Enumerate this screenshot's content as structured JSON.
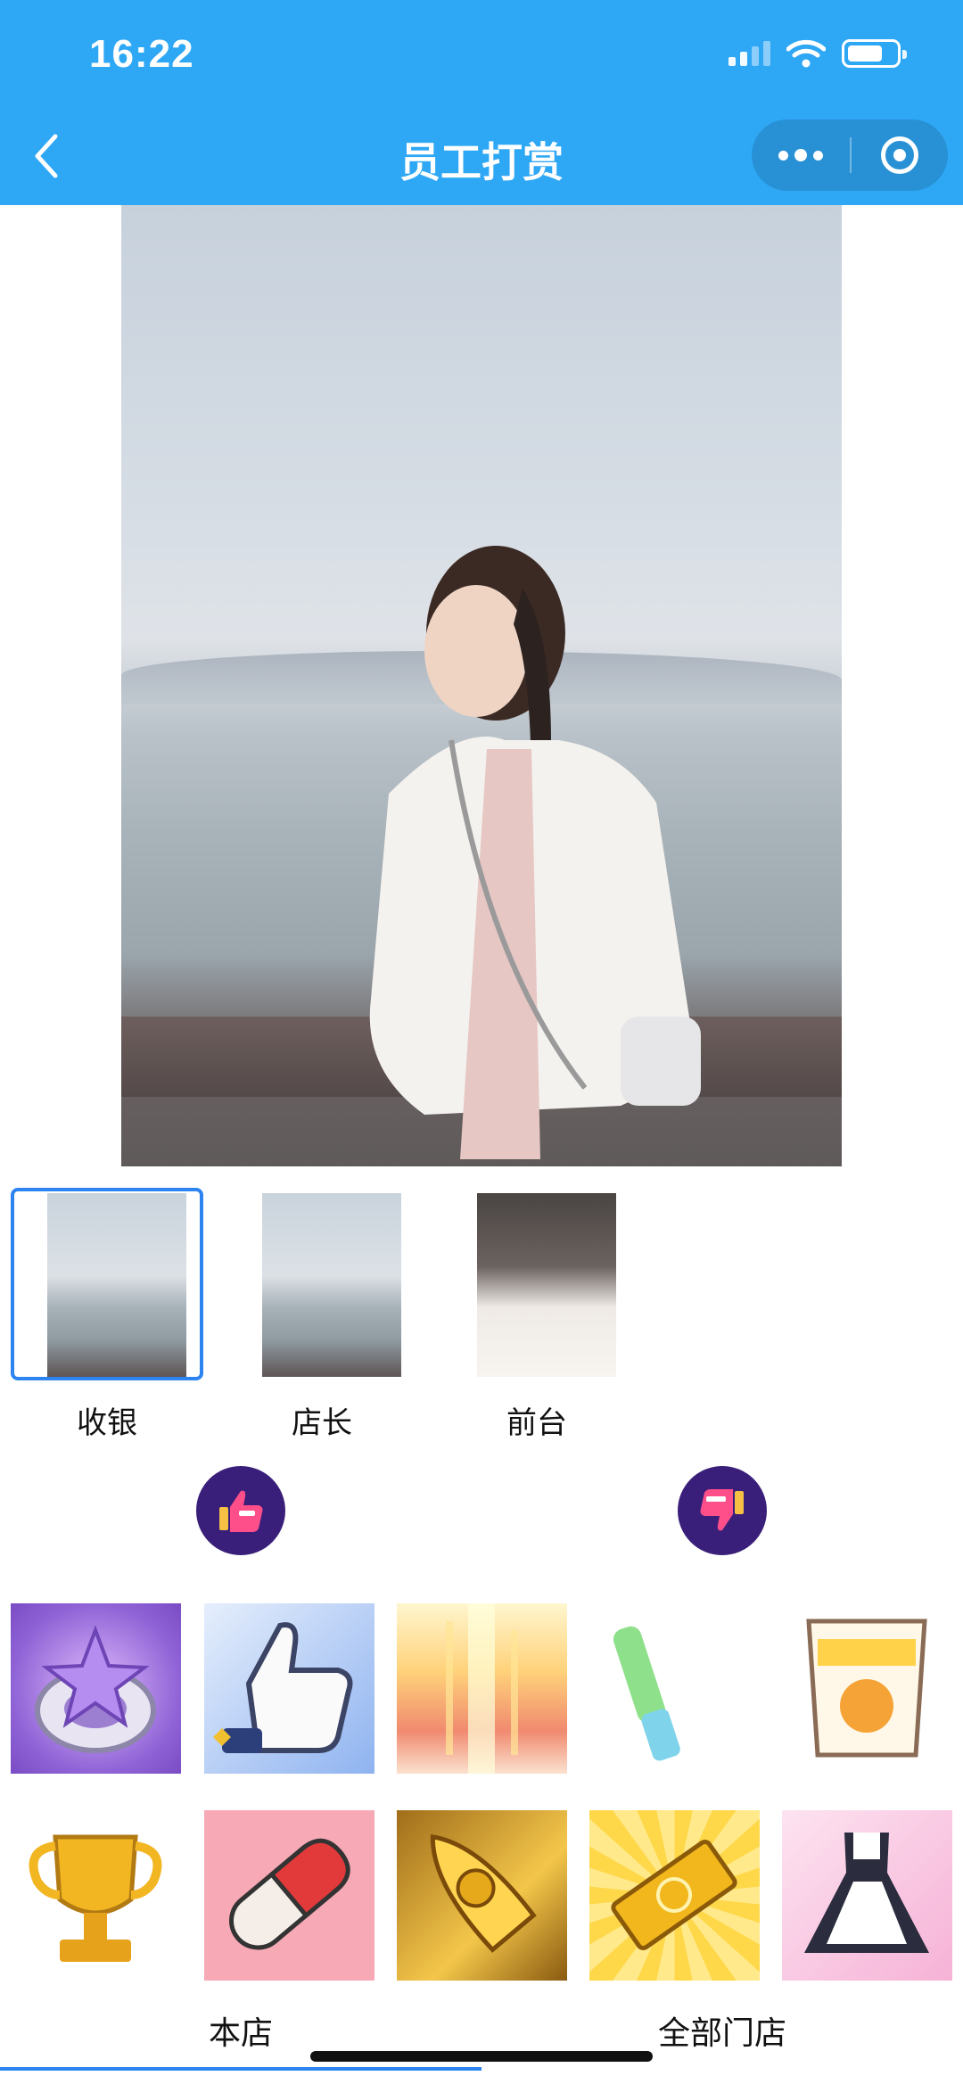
{
  "status_bar": {
    "time": "16:22"
  },
  "header": {
    "title": "员工打赏"
  },
  "staff": [
    {
      "name": "收银",
      "selected": true
    },
    {
      "name": "店长",
      "selected": false
    },
    {
      "name": "前台",
      "selected": false
    }
  ],
  "votes": {
    "up_icon": "thumbs-up-icon",
    "down_icon": "thumbs-down-icon"
  },
  "gifts": [
    "gem-ring-icon",
    "thumbs-up-glove-icon",
    "golden-light-icon",
    "glow-stick-icon",
    "snack-bag-icon",
    "trophy-icon",
    "pill-capsule-icon",
    "golden-rocket-icon",
    "gold-bar-icon",
    "maid-dress-icon"
  ],
  "tabs": [
    {
      "label": "本店",
      "active": true
    },
    {
      "label": "全部门店",
      "active": false
    }
  ],
  "colors": {
    "header": "#2ea7f5",
    "accent": "#2d84f0",
    "vote_bg": "#3a1f7a"
  }
}
